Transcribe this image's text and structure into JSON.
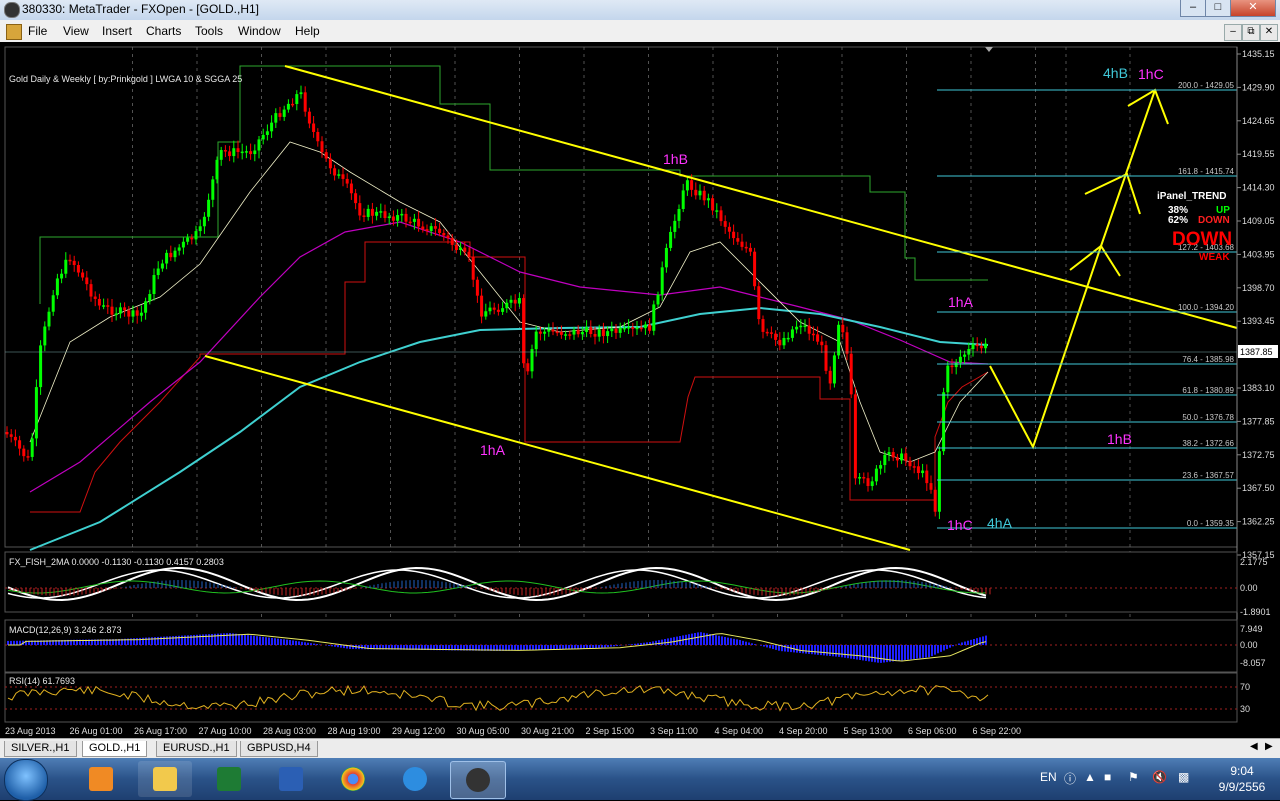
{
  "window": {
    "title": "380330: MetaTrader - FXOpen - [GOLD.,H1]"
  },
  "menu": [
    "File",
    "View",
    "Insert",
    "Charts",
    "Tools",
    "Window",
    "Help"
  ],
  "chart": {
    "header": "Gold Daily & Weekly [ by:Prinkgold ] LWGA 10  &  SGGA 25",
    "current_price": "1387.85",
    "price_axis": [
      "1435.15",
      "1429.90",
      "1424.65",
      "1419.55",
      "1414.30",
      "1409.05",
      "1403.95",
      "1398.70",
      "1393.45",
      "1383.10",
      "1377.85",
      "1372.75",
      "1367.50",
      "1362.25",
      "1357.15"
    ],
    "time_axis": [
      "23 Aug 2013",
      "26 Aug 01:00",
      "26 Aug 17:00",
      "27 Aug 10:00",
      "28 Aug 03:00",
      "28 Aug 19:00",
      "29 Aug 12:00",
      "30 Aug 05:00",
      "30 Aug 21:00",
      "2 Sep 15:00",
      "3 Sep 11:00",
      "4 Sep 04:00",
      "4 Sep 20:00",
      "5 Sep 13:00",
      "6 Sep 06:00",
      "6 Sep 22:00"
    ],
    "fib_levels": [
      "200.0 - 1429.05",
      "161.8 - 1415.74",
      "127.2 - 1403.68",
      "100.0 - 1394.20",
      "76.4 - 1385.98",
      "61.8 - 1380.89",
      "50.0 - 1376.78",
      "38.2 - 1372.66",
      "23.6 - 1367.57",
      "0.0 - 1359.35"
    ],
    "wave_labels": {
      "hb_top": "1hB",
      "ha_low": "1hA",
      "ha_right": "1hA",
      "hb_right": "1hB",
      "hc_low": "1hC",
      "fourA": "4hA",
      "fourB": "4hB",
      "hc_top": "1hC"
    },
    "ipanel": {
      "title": "iPanel_TREND",
      "pct_up": "38%",
      "up": "UP",
      "pct_down": "62%",
      "down": "DOWN",
      "big": "DOWN",
      "weak": "WEAK"
    },
    "colors": {
      "bull": "#00ff00",
      "bear": "#ff0000",
      "channel": "#ffff00",
      "fib": "#40c8d8",
      "wave_magenta": "#ff33ff",
      "wave_cyan": "#40c8d8",
      "ma_cyan": "#3fd0d0",
      "ma_magenta": "#c000c0"
    }
  },
  "indicators": {
    "fisher": {
      "label": "FX_FISH_2MA 0.0000 -0.1130 -0.1130 0.4157 0.2803",
      "ticks": [
        "2.1775",
        "0.00",
        "-1.8901"
      ]
    },
    "macd": {
      "label": "MACD(12,26,9) 3.246 2.873",
      "ticks": [
        "7.949",
        "0.00",
        "-8.057"
      ]
    },
    "rsi": {
      "label": "RSI(14) 61.7693",
      "ticks": [
        "70",
        "30"
      ]
    }
  },
  "tabs": [
    "SILVER.,H1",
    "GOLD.,H1",
    "EURUSD.,H1",
    "GBPUSD,H4"
  ],
  "active_tab": "GOLD.,H1",
  "taskbar": {
    "lang": "EN",
    "time": "9:04",
    "date": "9/9/2556"
  }
}
